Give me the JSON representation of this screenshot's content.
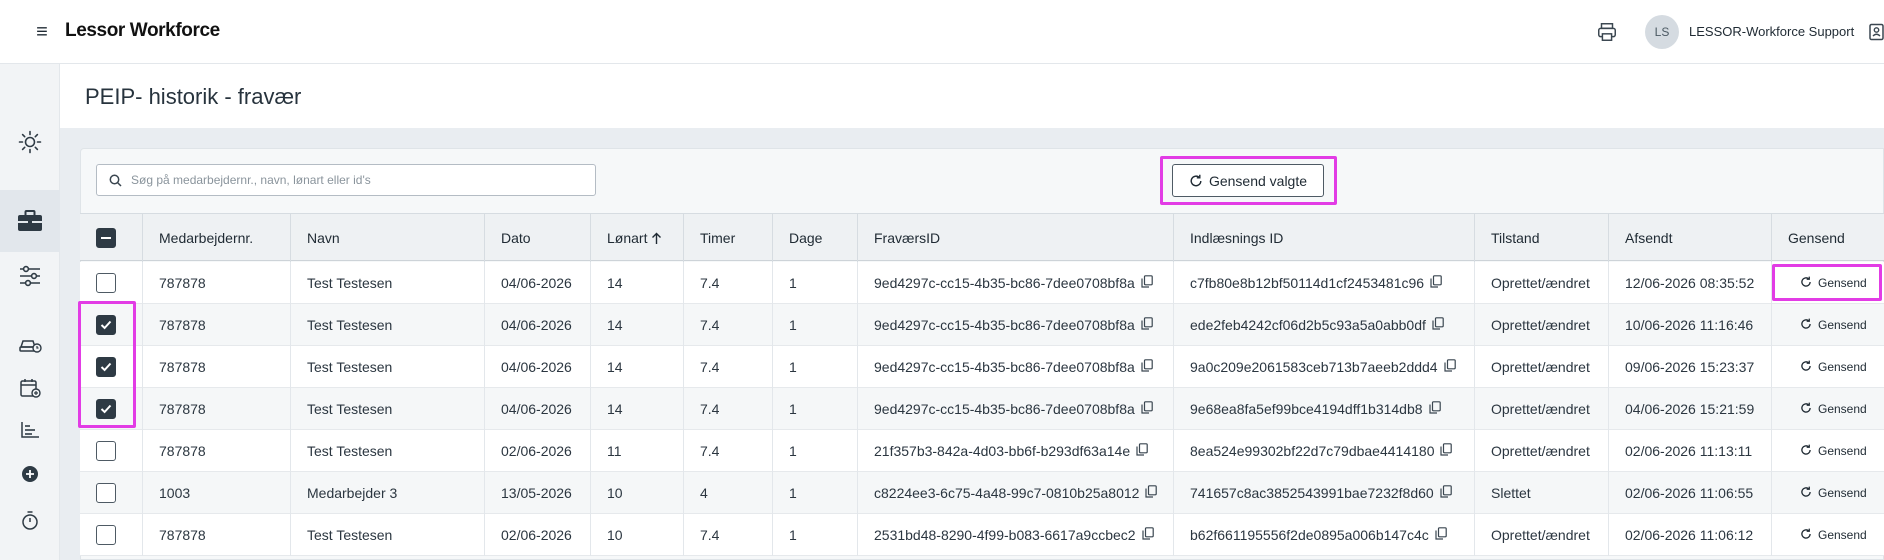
{
  "app": {
    "brand": "Lessor Workforce",
    "accent": "#e23ce5",
    "corner_color": "#8b7cf6"
  },
  "user": {
    "initials": "LS",
    "name": "LESSOR-Workforce Support"
  },
  "page": {
    "title": "PEIP- historik - fravær"
  },
  "search": {
    "placeholder": "Søg på medarbejdernr., navn, lønart eller id's"
  },
  "toolbar": {
    "resend_selected_label": "Gensend valgte"
  },
  "sidebar": {
    "items": [
      {
        "icon": "sun-icon"
      },
      {
        "icon": "briefcase-icon",
        "active": true
      },
      {
        "icon": "sliders-icon"
      },
      {
        "icon": "car-clock-icon"
      },
      {
        "icon": "calendar-add-icon"
      },
      {
        "icon": "bar-chart-icon"
      },
      {
        "icon": "add-circle-icon"
      },
      {
        "icon": "stopwatch-icon"
      }
    ]
  },
  "table": {
    "columns": {
      "employee_no": "Medarbejdernr.",
      "name": "Navn",
      "date": "Dato",
      "wage_type": "Lønart",
      "hours": "Timer",
      "days": "Dage",
      "absence_id": "FraværsID",
      "import_id": "Indlæsnings ID",
      "state": "Tilstand",
      "sent": "Afsendt",
      "resend": "Gensend"
    },
    "sorted_column": "wage_type",
    "sort_direction": "ascending",
    "resend_label": "Gensend",
    "rows": [
      {
        "checked": false,
        "employee_no": "787878",
        "name": "Test Testesen",
        "date": "04/06-2026",
        "wage_type": "14",
        "hours": "7.4",
        "days": "1",
        "absence_id": "9ed4297c-cc15-4b35-bc86-7dee0708bf8a",
        "import_id": "c7fb80e8b12bf50114d1cf2453481c96",
        "state": "Oprettet/ændret",
        "sent": "12/06-2026 08:35:52"
      },
      {
        "checked": true,
        "employee_no": "787878",
        "name": "Test Testesen",
        "date": "04/06-2026",
        "wage_type": "14",
        "hours": "7.4",
        "days": "1",
        "absence_id": "9ed4297c-cc15-4b35-bc86-7dee0708bf8a",
        "import_id": "ede2feb4242cf06d2b5c93a5a0abb0df",
        "state": "Oprettet/ændret",
        "sent": "10/06-2026 11:16:46"
      },
      {
        "checked": true,
        "employee_no": "787878",
        "name": "Test Testesen",
        "date": "04/06-2026",
        "wage_type": "14",
        "hours": "7.4",
        "days": "1",
        "absence_id": "9ed4297c-cc15-4b35-bc86-7dee0708bf8a",
        "import_id": "9a0c209e2061583ceb713b7aeeb2ddd4",
        "state": "Oprettet/ændret",
        "sent": "09/06-2026 15:23:37"
      },
      {
        "checked": true,
        "employee_no": "787878",
        "name": "Test Testesen",
        "date": "04/06-2026",
        "wage_type": "14",
        "hours": "7.4",
        "days": "1",
        "absence_id": "9ed4297c-cc15-4b35-bc86-7dee0708bf8a",
        "import_id": "9e68ea8fa5ef99bce4194dff1b314db8",
        "state": "Oprettet/ændret",
        "sent": "04/06-2026 15:21:59"
      },
      {
        "checked": false,
        "employee_no": "787878",
        "name": "Test Testesen",
        "date": "02/06-2026",
        "wage_type": "11",
        "hours": "7.4",
        "days": "1",
        "absence_id": "21f357b3-842a-4d03-bb6f-b293df63a14e",
        "import_id": "8ea524e99302bf22d7c79dbae4414180",
        "state": "Oprettet/ændret",
        "sent": "02/06-2026 11:13:11"
      },
      {
        "checked": false,
        "employee_no": "1003",
        "name": "Medarbejder 3",
        "date": "13/05-2026",
        "wage_type": "10",
        "hours": "4",
        "days": "1",
        "absence_id": "c8224ee3-6c75-4a48-99c7-0810b25a8012",
        "import_id": "741657c8ac3852543991bae7232f8d60",
        "state": "Slettet",
        "sent": "02/06-2026 11:06:55"
      },
      {
        "checked": false,
        "employee_no": "787878",
        "name": "Test Testesen",
        "date": "02/06-2026",
        "wage_type": "10",
        "hours": "7.4",
        "days": "1",
        "absence_id": "2531bd48-8290-4f99-b083-6617a9ccbec2",
        "import_id": "b62f661195556f2de0895a006b147c4c",
        "state": "Oprettet/ændret",
        "sent": "02/06-2026 11:06:12"
      }
    ]
  }
}
